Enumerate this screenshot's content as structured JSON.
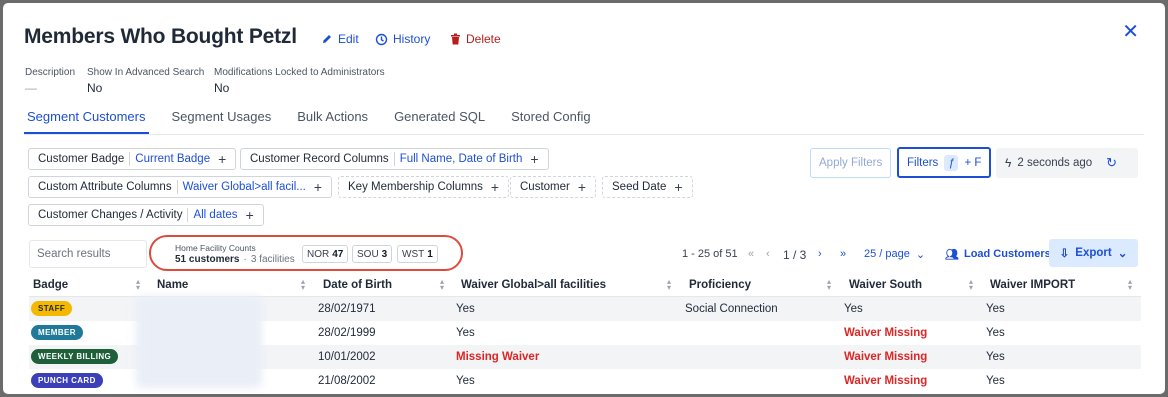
{
  "header": {
    "title": "Members Who Bought Petzl",
    "edit_label": "Edit",
    "history_label": "History",
    "delete_label": "Delete",
    "close_glyph": "✕"
  },
  "meta": {
    "description_label": "Description",
    "description_value": "—",
    "advanced_search_label": "Show In Advanced Search",
    "advanced_search_value": "No",
    "locked_label": "Modifications Locked to Administrators",
    "locked_value": "No"
  },
  "tabs": [
    "Segment Customers",
    "Segment Usages",
    "Bulk Actions",
    "Generated SQL",
    "Stored Config"
  ],
  "filters": {
    "chips": [
      {
        "label": "Customer Badge",
        "value": "Current Badge"
      },
      {
        "label": "Customer Record Columns",
        "value": "Full Name, Date of Birth"
      },
      {
        "label": "Custom Attribute Columns",
        "value": "Waiver Global>all facil..."
      },
      {
        "label": "Key Membership Columns",
        "value": ""
      },
      {
        "label": "Customer",
        "value": ""
      },
      {
        "label": "Seed Date",
        "value": ""
      },
      {
        "label": "Customer Changes / Activity",
        "value": "All dates"
      }
    ],
    "apply_label": "Apply Filters",
    "filters_label": "Filters",
    "shortcut_label": "+ F",
    "last_run_label": "2 seconds ago"
  },
  "toolbar": {
    "search_placeholder": "Search results",
    "hfc_title": "Home Facility Counts",
    "hfc_customers": "51 customers",
    "hfc_facilities": "3 facilities",
    "facilities": [
      {
        "code": "NOR",
        "count": "47"
      },
      {
        "code": "SOU",
        "count": "3"
      },
      {
        "code": "WST",
        "count": "1"
      }
    ],
    "range_label": "1 - 25 of 51",
    "page_label": "1 / 3",
    "per_page_label": "25 / page",
    "load_label": "Load Customers",
    "export_label": "Export"
  },
  "table": {
    "columns": [
      "Badge",
      "Name",
      "Date of Birth",
      "Waiver Global>all facilities",
      "Proficiency",
      "Waiver South",
      "Waiver IMPORT"
    ],
    "rows": [
      {
        "badge": "STAFF",
        "badge_bg": "#f5b800",
        "badge_fg": "#1f2937",
        "dob": "28/02/1971",
        "waiver_global": "Yes",
        "proficiency": "Social Connection",
        "waiver_south": "Yes",
        "waiver_import": "Yes"
      },
      {
        "badge": "MEMBER",
        "badge_bg": "#1f7a99",
        "badge_fg": "#ffffff",
        "dob": "28/02/1999",
        "waiver_global": "Yes",
        "proficiency": "",
        "waiver_south": "Waiver Missing",
        "waiver_import": "Yes"
      },
      {
        "badge": "WEEKLY BILLING",
        "badge_bg": "#1f5f3a",
        "badge_fg": "#ffffff",
        "dob": "10/01/2002",
        "waiver_global": "Missing Waiver",
        "proficiency": "",
        "waiver_south": "Waiver Missing",
        "waiver_import": "Yes"
      },
      {
        "badge": "PUNCH CARD",
        "badge_bg": "#3b3fb8",
        "badge_fg": "#ffffff",
        "dob": "21/08/2002",
        "waiver_global": "Yes",
        "proficiency": "",
        "waiver_south": "Waiver Missing",
        "waiver_import": "Yes"
      }
    ]
  },
  "colors": {
    "accent": "#1d4ed8",
    "danger": "#dc2626",
    "highlight_ring": "#dc4c3b"
  }
}
